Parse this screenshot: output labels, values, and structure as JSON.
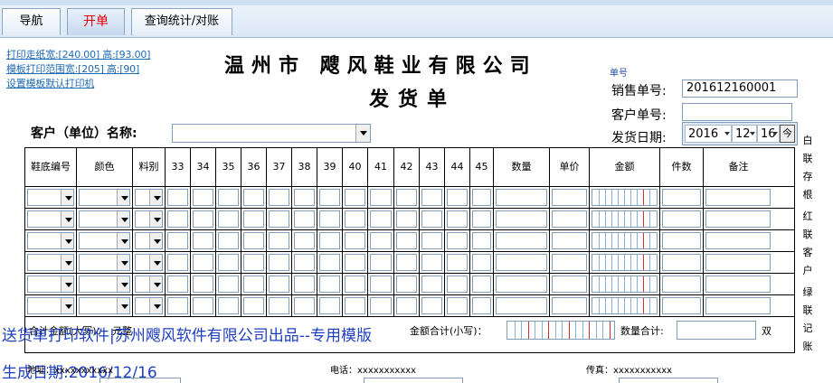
{
  "tabs": [
    {
      "label": "导航",
      "active": false
    },
    {
      "label": "开单",
      "active": true
    },
    {
      "label": "查询统计/对账",
      "active": false
    }
  ],
  "print_links": {
    "paper_size": "打印走纸宽:[240.00] 高:[93.00]",
    "template_range": "模板打印范围宽:[205] 高:[90]",
    "default_printer": "设置模板默认打印机"
  },
  "header": {
    "company": "温州市 飕风鞋业有限公司",
    "title": "发货单",
    "danhao_label": "单号",
    "sales_no_label": "销售单号:",
    "sales_no": "201612160001",
    "customer_no_label": "客户单号:",
    "customer_no": "",
    "ship_date_label": "发货日期:",
    "date": {
      "year": "2016",
      "month": "12",
      "day": "16",
      "today_button": "今"
    },
    "customer_label": "客户（单位）名称:",
    "customer_value": ""
  },
  "table": {
    "columns": [
      "鞋底编号",
      "颜色",
      "料别",
      "33",
      "34",
      "35",
      "36",
      "37",
      "38",
      "39",
      "40",
      "41",
      "42",
      "43",
      "44",
      "45",
      "数量",
      "单价",
      "金额",
      "件数",
      "备注"
    ],
    "row_count": 6
  },
  "copy_labels": [
    "白",
    "联",
    "存",
    "根",
    "红",
    "联",
    "客",
    "户",
    "绿",
    "联",
    "记",
    "账"
  ],
  "summary": {
    "amount_words_label": "合计金额(大写)：",
    "amount_words_suffix": "元整",
    "amount_small_label": "金额合计(小写)：",
    "qty_total_label": "数量合计:",
    "qty_unit": "双"
  },
  "watermark": {
    "line1": "送货单打印软件|苏州飕风软件有限公司出品--专用模版",
    "line2": "生成日期:2016/12/16"
  },
  "footer": {
    "address": "地址：xxxxxxxxxxx",
    "phone": "电话：xxxxxxxxxxx",
    "fax": "传真：xxxxxxxxxxx"
  },
  "colors": {
    "active_tab_text": "#e00000",
    "link": "#1f6bb3",
    "watermark": "#1e3fbf"
  }
}
